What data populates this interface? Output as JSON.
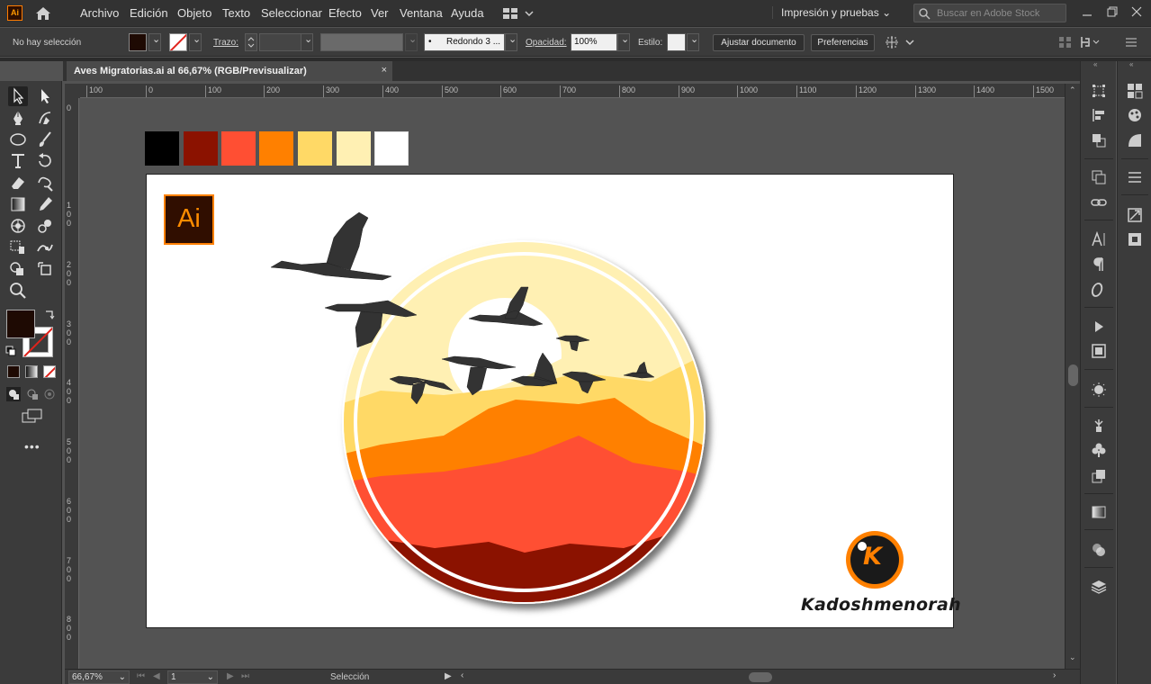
{
  "app": {
    "badge": "Ai"
  },
  "menu": [
    "Archivo",
    "Edición",
    "Objeto",
    "Texto",
    "Seleccionar",
    "Efecto",
    "Ver",
    "Ventana",
    "Ayuda"
  ],
  "workspace": "Impresión y pruebas",
  "stock_search": {
    "placeholder": "Buscar en Adobe Stock"
  },
  "control": {
    "selection": "No hay selección",
    "stroke_label": "Trazo:",
    "brush": "Redondo 3 ...",
    "opacity_label": "Opacidad:",
    "opacity": "100%",
    "style_label": "Estilo:",
    "fit_button": "Ajustar documento",
    "prefs_button": "Preferencias"
  },
  "document_tab": {
    "title": "Aves Migratorias.ai al 66,67% (RGB/Previsualizar)",
    "close": "×"
  },
  "ruler_h": [
    "100",
    "0",
    "100",
    "200",
    "300",
    "400",
    "500",
    "600",
    "700",
    "800",
    "900",
    "1000",
    "1100",
    "1200",
    "1300",
    "1400",
    "1500"
  ],
  "ruler_v": [
    "0",
    "1 0 0",
    "2 0 0",
    "3 0 0",
    "4 0 0",
    "5 0 0",
    "6 0 0",
    "7 0 0",
    "8 0 0"
  ],
  "palette": [
    "#000000",
    "#8b1200",
    "#ff4f33",
    "#ff8000",
    "#ffd966",
    "#fff0b3",
    "#ffffff"
  ],
  "artwork": {
    "ai_logo": "Ai",
    "brand_letter": "K",
    "brand_name": "Kadoshmenorah",
    "colors": {
      "dark_red": "#8b1200",
      "red": "#ff4f33",
      "orange": "#ff8000",
      "yellow": "#ffd966",
      "pale": "#fff0b3",
      "bird": "#333333"
    }
  },
  "status": {
    "zoom": "66,67%",
    "page": "1",
    "tool": "Selección"
  },
  "colors": {
    "accent": "#ff8000",
    "fill": "#1e0a03",
    "ui_dark": "#323232",
    "ui_panel": "#3b3b3b"
  }
}
